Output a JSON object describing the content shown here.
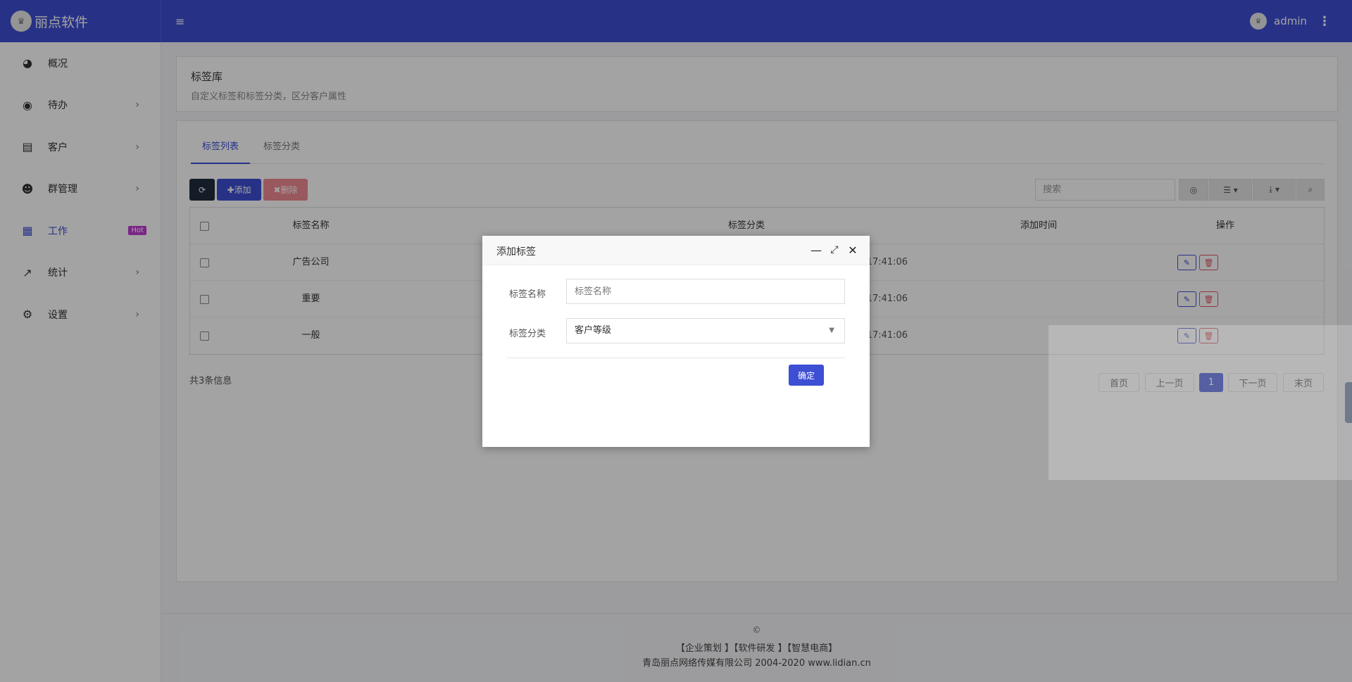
{
  "header": {
    "brand_title": "丽点软件",
    "user": "admin",
    "menu_icon": "hamburger-icon",
    "more_icon": "vertical-dots-icon"
  },
  "sidebar": {
    "items": [
      {
        "label": "概况",
        "icon": "dashboard-icon"
      },
      {
        "label": "待办",
        "icon": "compass-icon"
      },
      {
        "label": "客户",
        "icon": "id-card-icon"
      },
      {
        "label": "群管理",
        "icon": "users-icon"
      },
      {
        "label": "工作",
        "icon": "grid-icon",
        "badge": "Hot"
      },
      {
        "label": "统计",
        "icon": "line-chart-icon"
      },
      {
        "label": "设置",
        "icon": "gear-icon"
      }
    ]
  },
  "page": {
    "title": "标签库",
    "subtitle": "自定义标签和标签分类，区分客户属性"
  },
  "tabs": [
    "标签列表",
    "标签分类"
  ],
  "toolbar": {
    "add": "✚添加",
    "delete": "✖删除",
    "search_placeholder": "搜索"
  },
  "table": {
    "columns": [
      "标签名称",
      "标签分类",
      "添加时间",
      "操作"
    ],
    "rows": [
      {
        "name": "广告公司",
        "time": "21 17:41:06"
      },
      {
        "name": "重要",
        "time": "21 17:41:06"
      },
      {
        "name": "一般",
        "time": "21 17:41:06"
      }
    ]
  },
  "summary": "共3条信息",
  "pagination": [
    "首页",
    "上一页",
    "1",
    "下一页",
    "末页"
  ],
  "footer": {
    "copyright": "©",
    "links": "【企业策划 】【软件研发 】【智慧电商】",
    "company": "青岛丽点网络传媒有限公司 2004-2020 www.lidian.cn"
  },
  "modal": {
    "title": "添加标签",
    "name_label": "标签名称",
    "name_placeholder": "标签名称",
    "category_label": "标签分类",
    "category_value": "客户等级",
    "ok": "确定"
  },
  "colors": {
    "primary": "#3d4fd3",
    "danger": "#e05561",
    "hot_badge": "#c03bd4",
    "refresh_button": "#1f2d3d",
    "add_button": "#3d4fd3",
    "delete_button": "#f08a94"
  }
}
